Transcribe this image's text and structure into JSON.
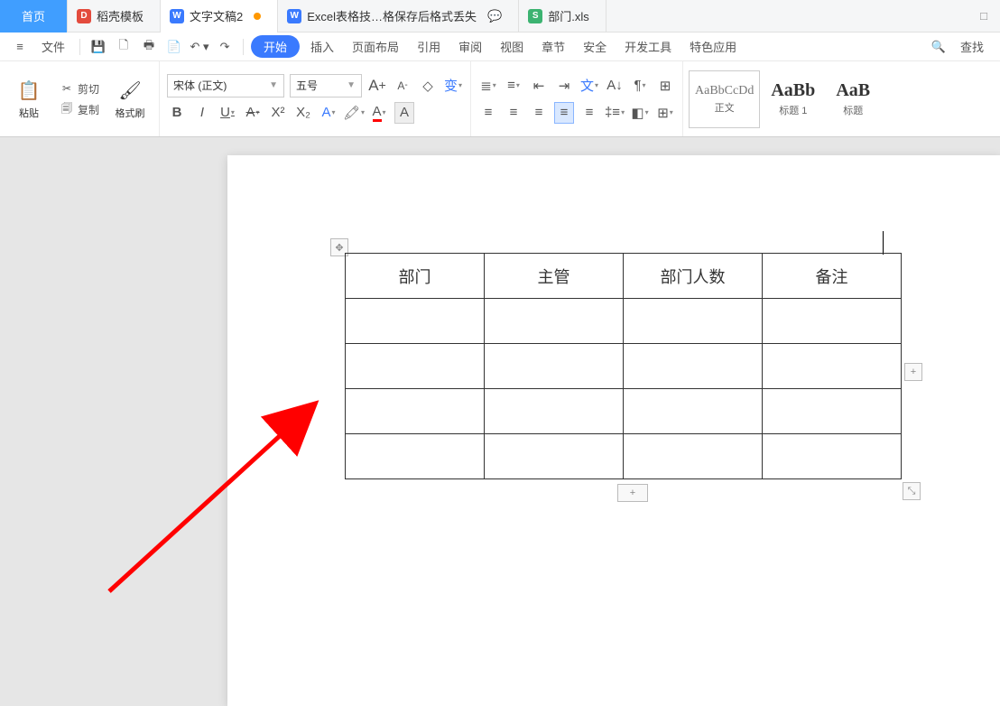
{
  "tabs": {
    "home": "首页",
    "template": "稻壳模板",
    "doc": "文字文稿2",
    "excel": "Excel表格技…格保存后格式丢失",
    "xls": "部门.xls"
  },
  "menu": {
    "file": "文件",
    "start": "开始",
    "insert": "插入",
    "pagelayout": "页面布局",
    "reference": "引用",
    "review": "审阅",
    "view": "视图",
    "section": "章节",
    "security": "安全",
    "devtools": "开发工具",
    "special": "特色应用",
    "find": "查找"
  },
  "ribbon": {
    "paste": "粘贴",
    "cut": "剪切",
    "copy": "复制",
    "formatpainter": "格式刷",
    "fontname": "宋体 (正文)",
    "fontsize": "五号",
    "styles": {
      "s1": {
        "sample": "AaBbCcDd",
        "caption": "正文"
      },
      "s2": {
        "sample": "AaBb",
        "caption": "标题 1"
      },
      "s3": {
        "sample": "AaB",
        "caption": "标题 "
      }
    }
  },
  "table": {
    "headers": [
      "部门",
      "主管",
      "部门人数",
      "备注"
    ],
    "rows": 4
  },
  "icons": {
    "move": "✥",
    "plus": "+",
    "resize": "⤡",
    "search": "🔍",
    "window": "□"
  }
}
